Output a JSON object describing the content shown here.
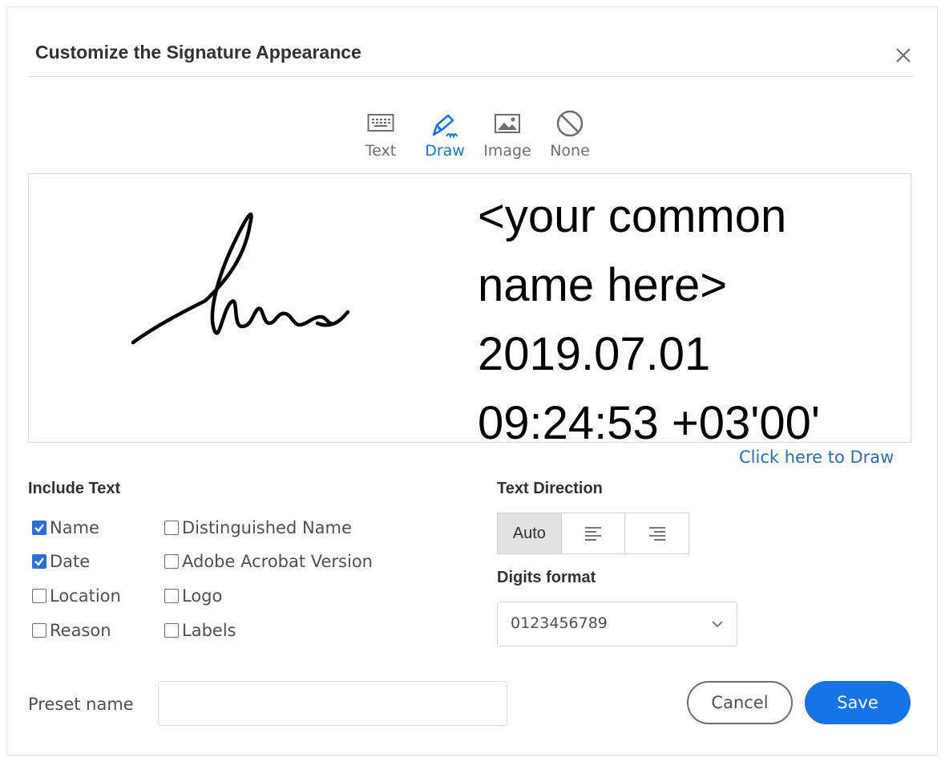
{
  "dialog": {
    "title": "Customize the Signature Appearance"
  },
  "tabs": [
    {
      "label": "Text",
      "icon": "keyboard-icon",
      "active": false
    },
    {
      "label": "Draw",
      "icon": "pen-icon",
      "active": true
    },
    {
      "label": "Image",
      "icon": "image-icon",
      "active": false
    },
    {
      "label": "None",
      "icon": "prohibited-icon",
      "active": false
    }
  ],
  "preview": {
    "lines": [
      "<your common",
      "name here>",
      "2019.07.01",
      "09:24:53 +03'00'"
    ]
  },
  "click_to_draw": "Click here to Draw",
  "include_text": {
    "label": "Include Text",
    "options": [
      {
        "label": "Name",
        "checked": true
      },
      {
        "label": "Date",
        "checked": true
      },
      {
        "label": "Location",
        "checked": false
      },
      {
        "label": "Reason",
        "checked": false
      },
      {
        "label": "Distinguished Name",
        "checked": false
      },
      {
        "label": "Adobe Acrobat Version",
        "checked": false
      },
      {
        "label": "Logo",
        "checked": false
      },
      {
        "label": "Labels",
        "checked": false
      }
    ]
  },
  "text_direction": {
    "label": "Text Direction",
    "auto_label": "Auto",
    "selected": "Auto",
    "options": [
      "Auto",
      "left-align-icon",
      "right-align-icon"
    ]
  },
  "digits_format": {
    "label": "Digits format",
    "value": "0123456789"
  },
  "preset": {
    "label": "Preset name",
    "value": "",
    "placeholder": ""
  },
  "buttons": {
    "cancel": "Cancel",
    "save": "Save"
  },
  "colors": {
    "accent": "#1473e6",
    "checkbox_checked": "#2d6fd9",
    "link": "#2d6fb3"
  }
}
